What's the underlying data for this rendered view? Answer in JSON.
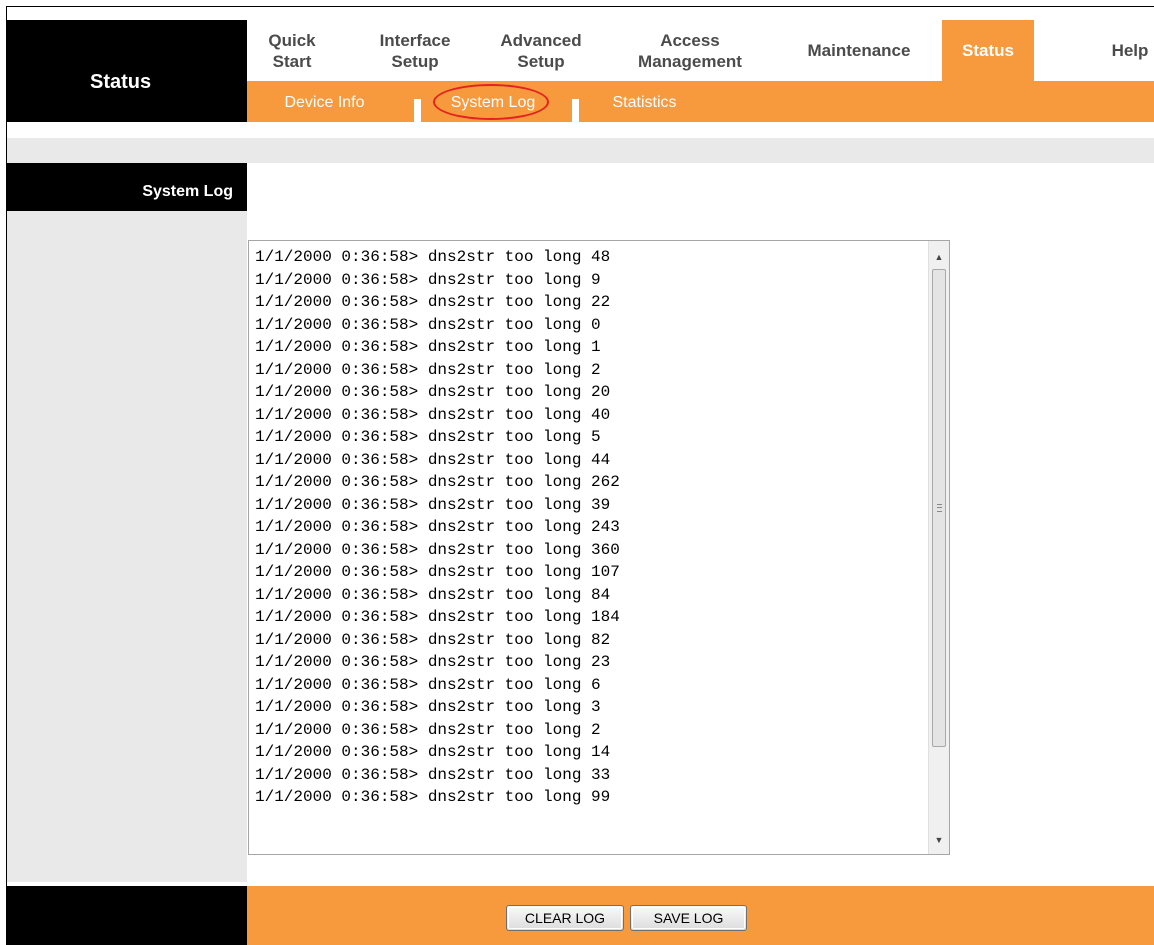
{
  "sidebar": {
    "title": "Status"
  },
  "nav": {
    "tabs": [
      {
        "label": "Quick\nStart"
      },
      {
        "label": "Interface\nSetup"
      },
      {
        "label": "Advanced\nSetup"
      },
      {
        "label": "Access\nManagement"
      },
      {
        "label": "Maintenance"
      },
      {
        "label": "Status",
        "active": true
      },
      {
        "label": "Help"
      }
    ],
    "subtabs": [
      {
        "label": "Device Info"
      },
      {
        "label": "System Log",
        "active": true
      },
      {
        "label": "Statistics"
      }
    ]
  },
  "section": {
    "title": "System Log"
  },
  "log": {
    "lines": [
      "1/1/2000 0:36:58> dns2str too long 48",
      "1/1/2000 0:36:58> dns2str too long 9",
      "1/1/2000 0:36:58> dns2str too long 22",
      "1/1/2000 0:36:58> dns2str too long 0",
      "1/1/2000 0:36:58> dns2str too long 1",
      "1/1/2000 0:36:58> dns2str too long 2",
      "1/1/2000 0:36:58> dns2str too long 20",
      "1/1/2000 0:36:58> dns2str too long 40",
      "1/1/2000 0:36:58> dns2str too long 5",
      "1/1/2000 0:36:58> dns2str too long 44",
      "1/1/2000 0:36:58> dns2str too long 262",
      "1/1/2000 0:36:58> dns2str too long 39",
      "1/1/2000 0:36:58> dns2str too long 243",
      "1/1/2000 0:36:58> dns2str too long 360",
      "1/1/2000 0:36:58> dns2str too long 107",
      "1/1/2000 0:36:58> dns2str too long 84",
      "1/1/2000 0:36:58> dns2str too long 184",
      "1/1/2000 0:36:58> dns2str too long 82",
      "1/1/2000 0:36:58> dns2str too long 23",
      "1/1/2000 0:36:58> dns2str too long 6",
      "1/1/2000 0:36:58> dns2str too long 3",
      "1/1/2000 0:36:58> dns2str too long 2",
      "1/1/2000 0:36:58> dns2str too long 14",
      "1/1/2000 0:36:58> dns2str too long 33",
      "1/1/2000 0:36:58> dns2str too long 99"
    ]
  },
  "buttons": {
    "clear_log": "CLEAR LOG",
    "save_log": "SAVE LOG"
  },
  "colors": {
    "accent": "#f7993d",
    "highlight": "#e32222"
  },
  "icons": {
    "scroll_up": "triangle-up-icon",
    "scroll_down": "triangle-down-icon"
  }
}
